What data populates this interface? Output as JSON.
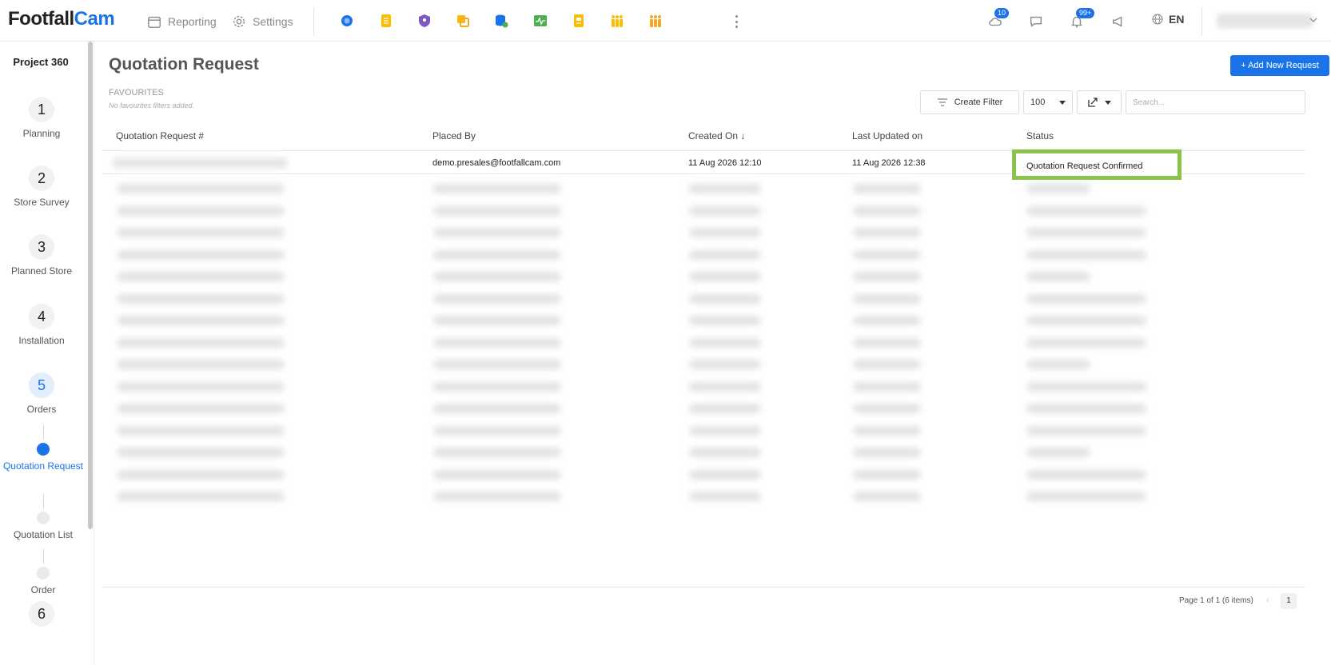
{
  "header": {
    "brand_main": "Footfall",
    "brand_accent": "Cam",
    "nav": [
      {
        "label": "Reporting",
        "icon": "calendar-icon"
      },
      {
        "label": "Settings",
        "icon": "gear-icon"
      }
    ],
    "apps": [
      {
        "icon": "support-headset-icon",
        "color": "#1a73e8"
      },
      {
        "icon": "document-icon",
        "color": "#fbbc04"
      },
      {
        "icon": "shield-user-icon",
        "color": "#7e57c2"
      },
      {
        "icon": "copy-squares-icon",
        "color": "#fbbc04"
      },
      {
        "icon": "database-check-icon",
        "color": "#1a73e8"
      },
      {
        "icon": "pulse-monitor-icon",
        "color": "#4caf50"
      },
      {
        "icon": "report-doc-icon",
        "color": "#fbbc04"
      },
      {
        "icon": "people-group-icon",
        "color": "#fbbc04"
      },
      {
        "icon": "people-group-alt-icon",
        "color": "#fbbc04"
      }
    ],
    "cloud_badge": "10",
    "bell_badge": "99+",
    "language": "EN"
  },
  "sidebar": {
    "project": "Project 360",
    "steps": [
      {
        "num": "1",
        "label": "Planning"
      },
      {
        "num": "2",
        "label": "Store Survey"
      },
      {
        "num": "3",
        "label": "Planned Store"
      },
      {
        "num": "4",
        "label": "Installation"
      },
      {
        "num": "5",
        "label": "Orders"
      },
      {
        "num": "6",
        "label": ""
      }
    ],
    "substeps": [
      {
        "label": "Quotation Request"
      },
      {
        "label": "Quotation List"
      },
      {
        "label": "Order"
      }
    ]
  },
  "main": {
    "title": "Quotation Request",
    "add_button": "+ Add New Request",
    "favourites_title": "FAVOURITES",
    "favourites_note": "No favourites filters added.",
    "create_filter": "Create Filter",
    "page_size": "100",
    "search_placeholder": "Search...",
    "columns": [
      "Quotation Request #",
      "Placed By",
      "Created On ↓",
      "Last Updated on",
      "Status"
    ],
    "first_row": {
      "placed_by": "demo.presales@footfallcam.com",
      "created_on": "11 Aug 2026 12:10",
      "last_updated": "11 Aug 2026 12:38",
      "status": "Quotation Request Confirmed"
    },
    "highlight_color": "#8bc34a",
    "page_info": "Page 1 of 1 (6 items)",
    "page_number": "1",
    "prev_arrow": "‹"
  },
  "colors": {
    "accent": "#1a73e8"
  }
}
